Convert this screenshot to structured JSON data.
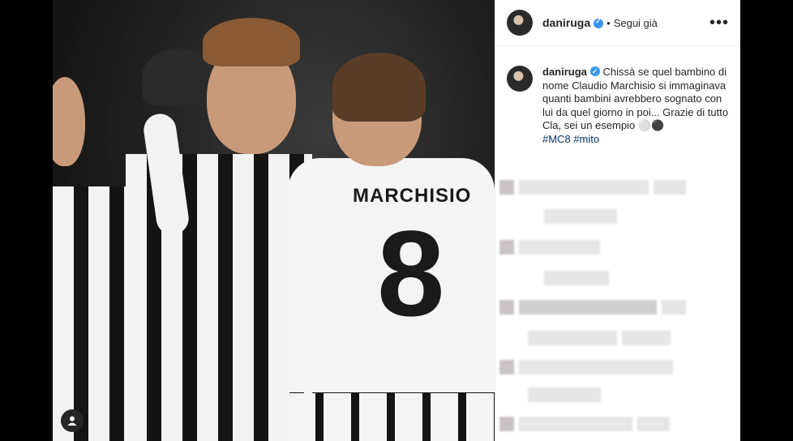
{
  "post": {
    "username": "daniruga",
    "follow_separator": "•",
    "follow_status": "Segui già",
    "more_label": "•••"
  },
  "caption": {
    "username": "daniruga",
    "text": "Chissà se quel bambino di nome Claudio Marchisio si immaginava quanti bambini avrebbero sognato con lui da quel giorno in poi... Grazie di tutto Cla, sei un esempio ⚪⚫",
    "hashtags": "#MC8 #mito"
  },
  "photo": {
    "jersey_name": "MARCHISIO",
    "jersey_number": "8"
  },
  "colors": {
    "accent": "#3897f0",
    "hashtag": "#003569",
    "text": "#262626"
  }
}
